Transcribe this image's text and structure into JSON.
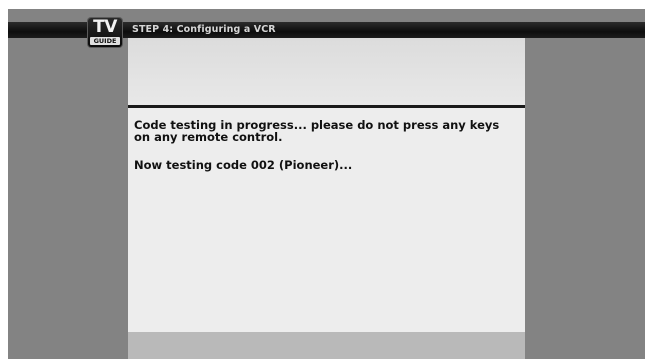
{
  "header": {
    "logo_top": "TV",
    "logo_bottom": "GUIDE",
    "step_title": "STEP 4: Configuring a VCR"
  },
  "panel": {
    "message": "Code testing in progress... please do not press any keys on any remote control.",
    "status": "Now testing code 002 (Pioneer)..."
  },
  "colors": {
    "screen_bg": "#838383",
    "header_bar": "#111111",
    "panel_bg": "#ececec",
    "divider": "#1a1a1a",
    "panel_footer": "#b9b9b9"
  }
}
